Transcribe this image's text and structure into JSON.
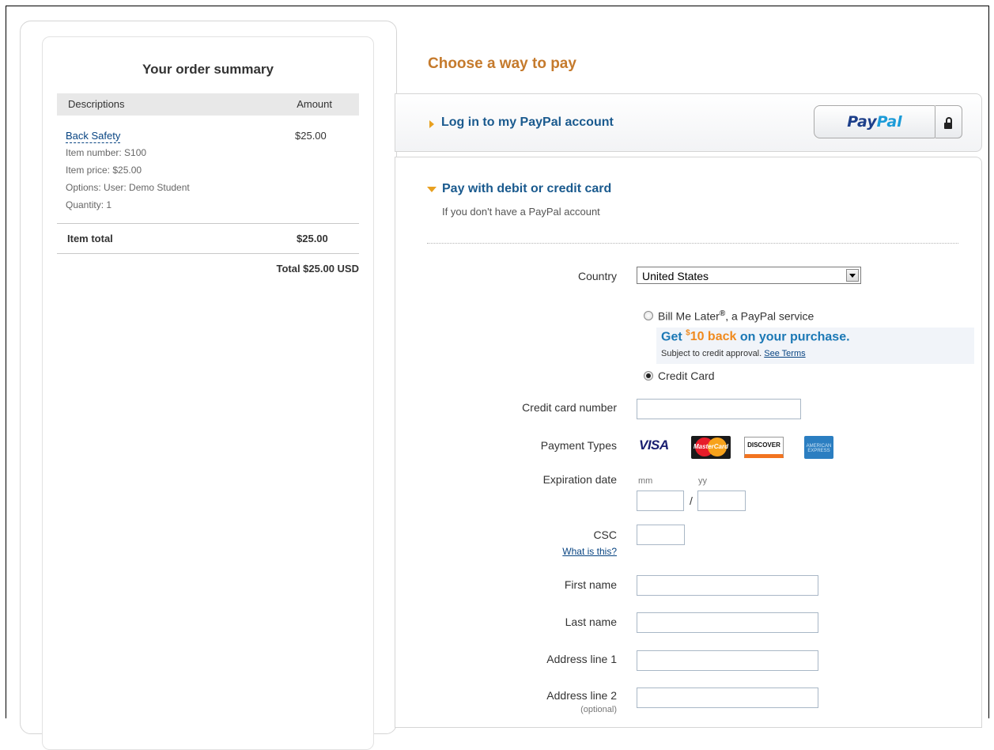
{
  "summary": {
    "title": "Your order summary",
    "col_desc": "Descriptions",
    "col_amount": "Amount",
    "item_name": "Back Safety",
    "item_amount": "$25.00",
    "item_number": "Item number: S100",
    "item_price": "Item price: $25.00",
    "item_options": "Options: User: Demo Student",
    "item_quantity": "Quantity: 1",
    "item_total_label": "Item total",
    "item_total_value": "$25.00",
    "grand_total": "Total $25.00 USD"
  },
  "pay": {
    "heading": "Choose a way to pay",
    "login_label": "Log in to my PayPal account",
    "paypal_logo_pay": "Pay",
    "paypal_logo_pal": "Pal",
    "card_title": "Pay with debit or credit card",
    "card_subtitle": "If you don't have a PayPal account"
  },
  "form": {
    "country_label": "Country",
    "country_value": "United States",
    "bml_label": "Bill Me Later",
    "bml_reg": "®",
    "bml_suffix": ", a PayPal service",
    "promo_get": "Get ",
    "promo_dollar": "$",
    "promo_amount": "10 back",
    "promo_rest": " on your purchase.",
    "subject_text": "Subject to credit approval. ",
    "see_terms": "See Terms",
    "credit_card_option": "Credit Card",
    "cc_number_label": "Credit card number",
    "payment_types_label": "Payment Types",
    "visa": "VISA",
    "mastercard": "MasterCard",
    "discover": "DISCOVER",
    "amex": "AMERICAN EXPRESS",
    "expiration_label": "Expiration date",
    "mm": "mm",
    "yy": "yy",
    "slash": "/",
    "csc_label": "CSC",
    "what_is_this": "What is this?",
    "first_name_label": "First name",
    "last_name_label": "Last name",
    "address1_label": "Address line 1",
    "address2_label": "Address line 2",
    "optional": "(optional)"
  },
  "colors": {
    "heading_orange": "#c57a2c",
    "link_blue": "#1a5a8e",
    "promo_blue": "#1b78b5"
  }
}
